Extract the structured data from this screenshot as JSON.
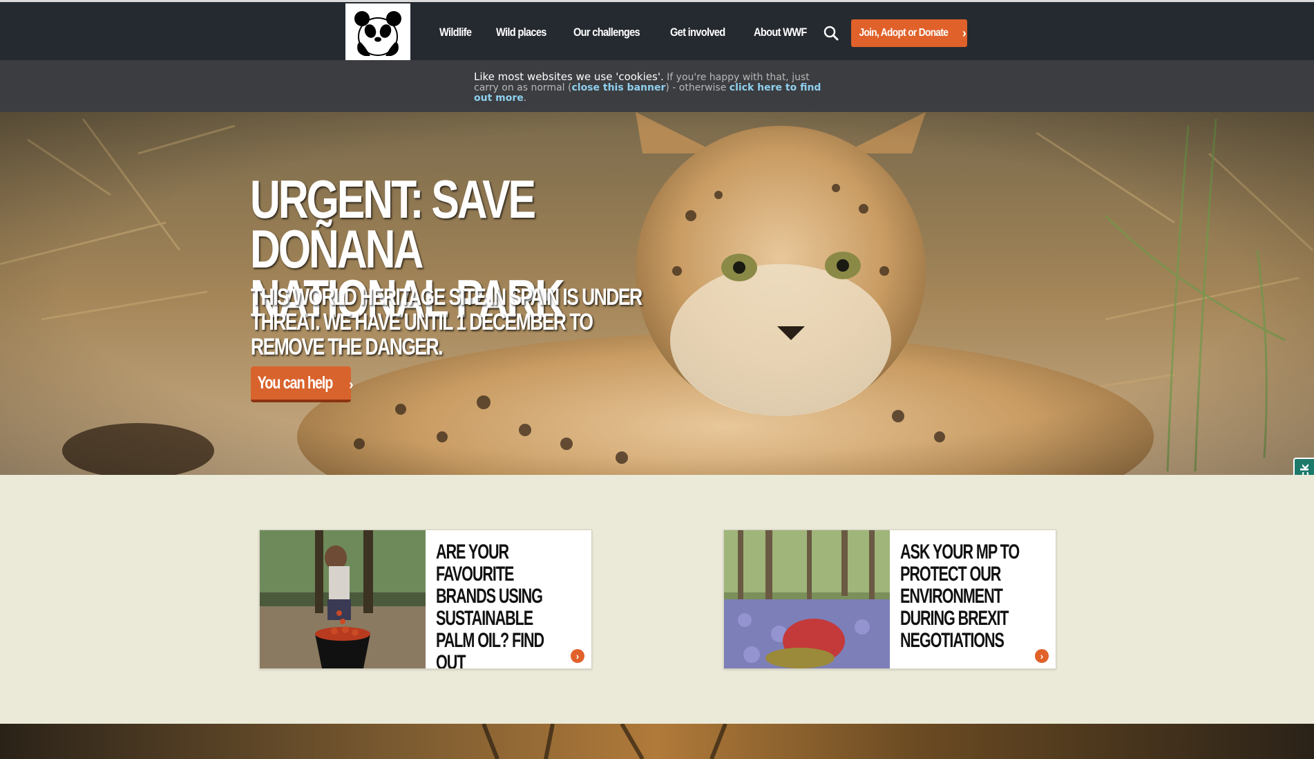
{
  "header": {
    "logo_alt": "WWF panda",
    "nav": [
      "Wildlife",
      "Wild places",
      "Our challenges",
      "Get involved",
      "About WWF"
    ],
    "search_icon": "search-icon",
    "donate_label": "Join, Adopt or Donate",
    "donate_chevron": "›"
  },
  "cookie_banner": {
    "lead": "Like most websites we use 'cookies'.",
    "text1": " If you're happy with that, just carry on as normal (",
    "close_link": "close this banner",
    "text2": ") - otherwise ",
    "more_link": "click here to find out more",
    "text3": "."
  },
  "hero": {
    "title": "URGENT: SAVE DOÑANA\nNATIONAL PARK",
    "subtitle": "THIS WORLD HERITAGE SITE IN SPAIN IS UNDER THREAT. WE HAVE UNTIL 1 DECEMBER TO REMOVE THE DANGER.",
    "cta_label": "You can help",
    "cta_chevron": "›"
  },
  "feedback_label": "feedback",
  "cards": [
    {
      "title": "ARE YOUR FAVOURITE BRANDS USING SUSTAINABLE PALM OIL? FIND OUT",
      "arrow": "›"
    },
    {
      "title": "ASK YOUR MP TO PROTECT OUR ENVIRONMENT DURING BREXIT NEGOTIATIONS",
      "arrow": "›"
    }
  ],
  "colors": {
    "header_bg": "#252a31",
    "accent": "#e0622a",
    "cookie_bg": "#3b3d40",
    "link": "#8fd0ee",
    "page_bg": "#ebe9d8",
    "feedback_bg": "#1d7a6b"
  }
}
